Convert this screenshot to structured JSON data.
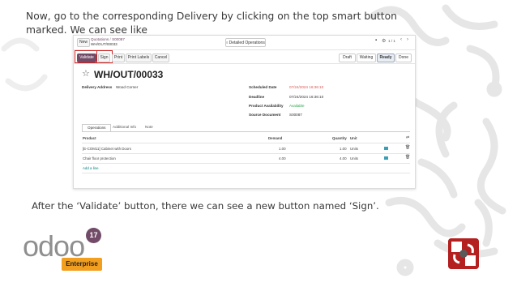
{
  "slide": {
    "top_text": "Now, go to the corresponding Delivery by clicking on the top smart button marked. We can see like",
    "bottom_text": "After the ‘Validate’ button, there we can see a new button named ‘Sign’.",
    "odoo_logo_text": "odoo",
    "odoo_version": "17",
    "enterprise_label": "Enterprise"
  },
  "odoo": {
    "new_label": "New",
    "breadcrumb_parent": "Quotations",
    "breadcrumb_sep": "/",
    "breadcrumb_current": "S00087",
    "record_ref": "WH/OUT/00033",
    "detailed_ops_label": "Detailed Operations",
    "pager": "1 / 1",
    "buttons": {
      "validate": "Validate",
      "sign": "Sign",
      "print": "Print",
      "print_labels": "Print Labels",
      "cancel": "Cancel"
    },
    "status": [
      "Draft",
      "Waiting",
      "Ready",
      "Done"
    ],
    "active_status": "Ready",
    "title": "WH/OUT/00033",
    "delivery_address_label": "Delivery Address",
    "delivery_address_value": "Wood Corner",
    "scheduled_date_label": "Scheduled Date",
    "scheduled_date_value": "07/24/2024 16:36:10",
    "deadline_label": "Deadline",
    "deadline_value": "07/24/2024 16:36:10",
    "availability_label": "Product Availability",
    "availability_value": "Available",
    "source_doc_label": "Source Document",
    "source_doc_value": "S00087",
    "tabs": [
      "Operations",
      "Additional Info",
      "Note"
    ],
    "table": {
      "headers": [
        "Product",
        "Demand",
        "Quantity",
        "Unit"
      ],
      "rows": [
        {
          "product": "[E-COM11] Cabinet with Doors",
          "demand": "1.00",
          "quantity": "1.00",
          "unit": "Units"
        },
        {
          "product": "Chair floor protection",
          "demand": "4.00",
          "quantity": "4.00",
          "unit": "Units"
        }
      ],
      "add_line": "Add a line"
    }
  },
  "colors": {
    "accent": "#714b67",
    "highlight": "#d01f1f",
    "available": "#28a745",
    "enterprise": "#f29e1f",
    "scheduled_date": "#d9534f"
  }
}
